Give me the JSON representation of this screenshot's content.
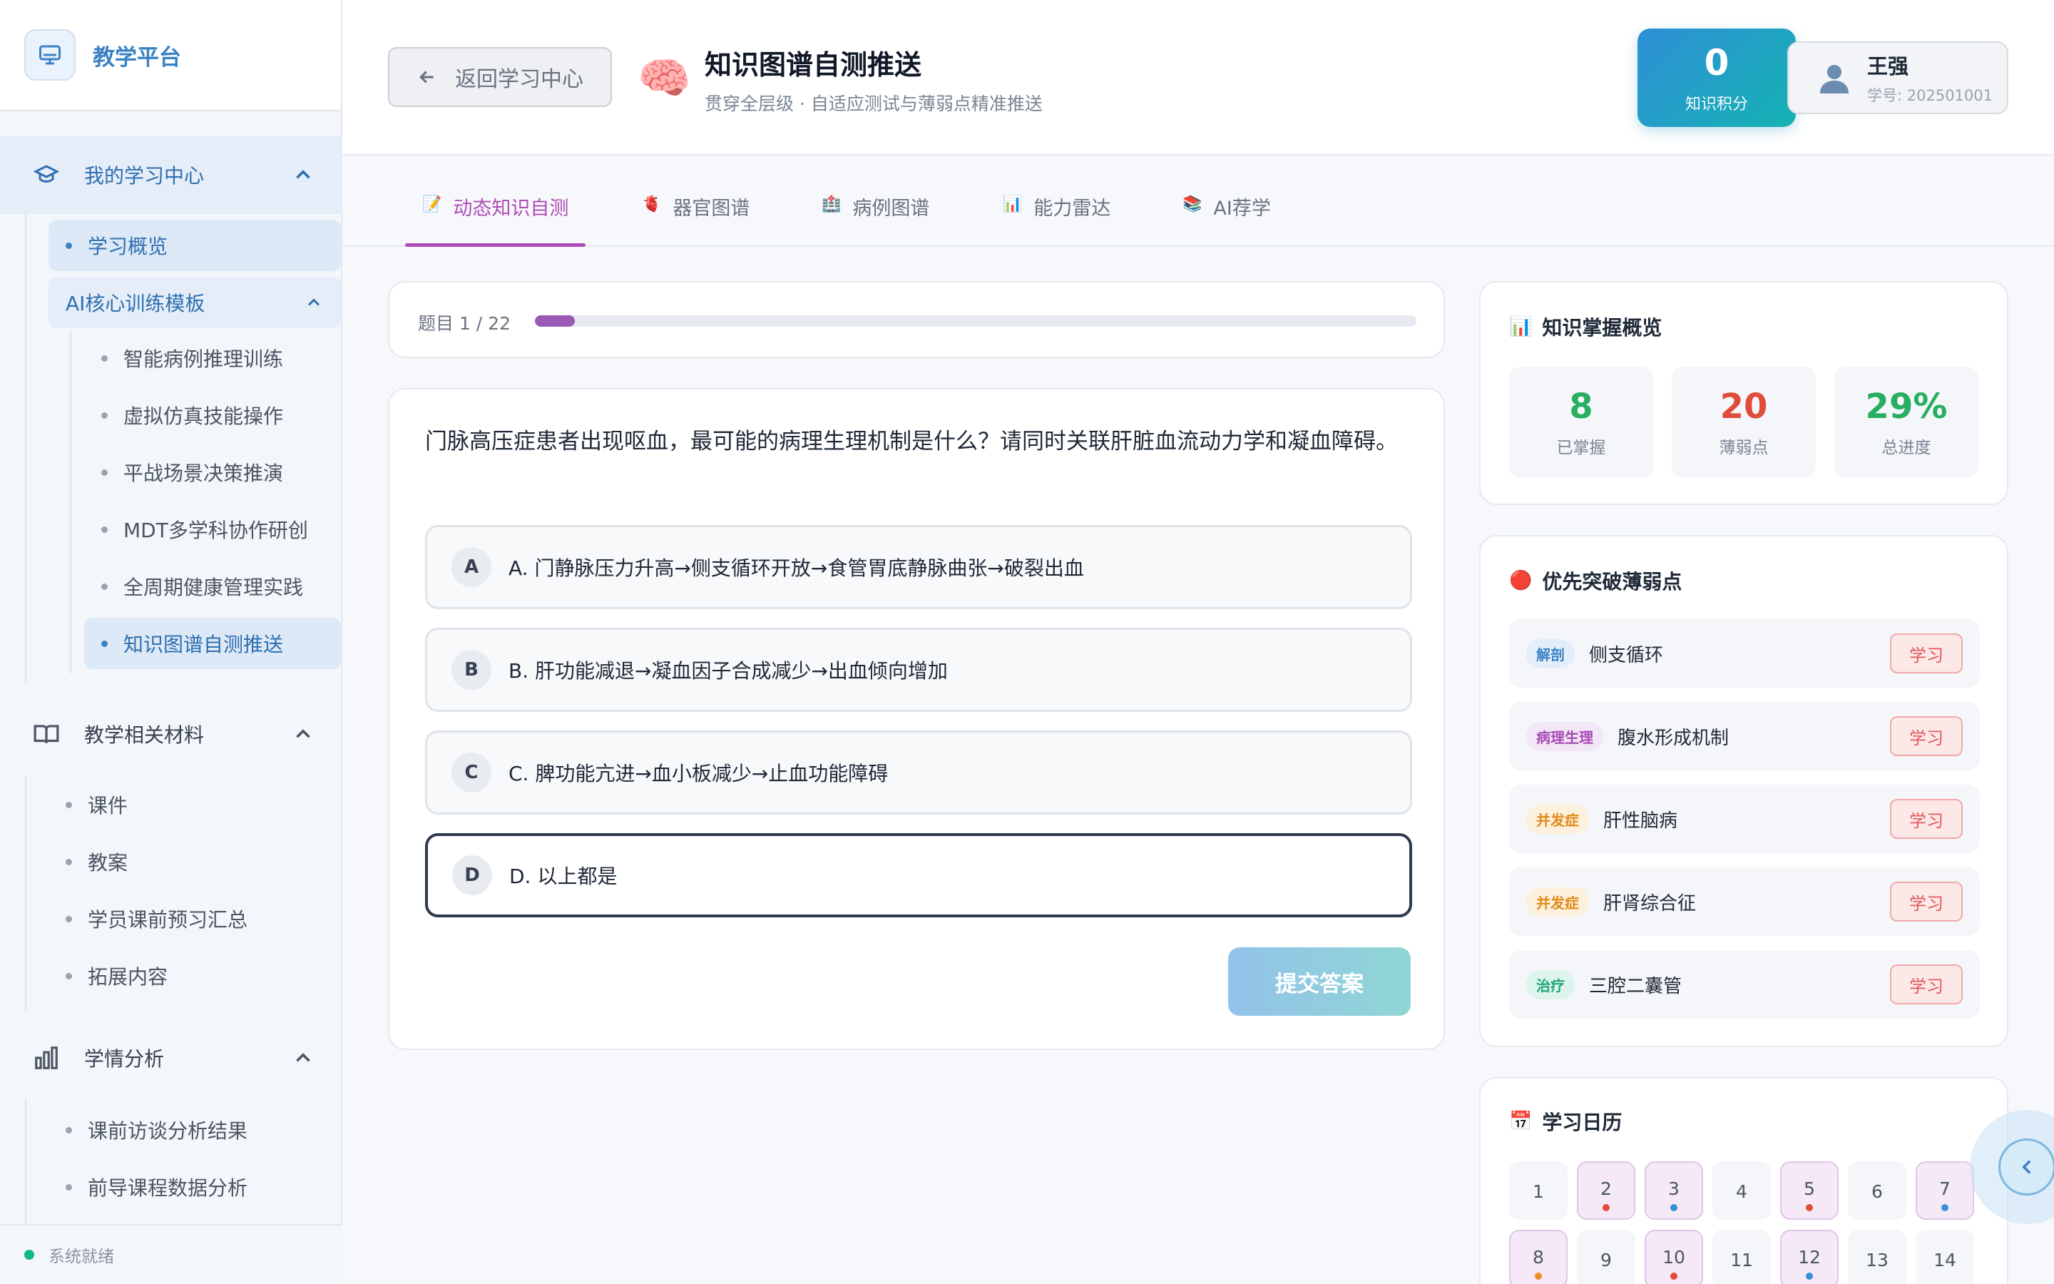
{
  "brand": {
    "name": "教学平台"
  },
  "sidebar": {
    "group1": {
      "label": "我的学习中心",
      "items": {
        "overview": "学习概览",
        "ai_template": "AI核心训练模板",
        "sub": [
          "智能病例推理训练",
          "虚拟仿真技能操作",
          "平战场景决策推演",
          "MDT多学科协作研创",
          "全周期健康管理实践",
          "知识图谱自测推送"
        ]
      }
    },
    "group2": {
      "label": "教学相关材料",
      "items": [
        "课件",
        "教案",
        "学员课前预习汇总",
        "拓展内容"
      ]
    },
    "group3": {
      "label": "学情分析",
      "items": [
        "课前访谈分析结果",
        "前导课程数据分析"
      ]
    },
    "status": "系统就绪"
  },
  "header": {
    "back_label": "返回学习中心",
    "title_icon": "🧠",
    "title": "知识图谱自测推送",
    "subtitle": "贯穿全层级 · 自适应测试与薄弱点精准推送",
    "points": {
      "value": "0",
      "label": "知识积分"
    },
    "user": {
      "name": "王强",
      "id": "学号: 202501001"
    }
  },
  "tabs": [
    {
      "icon": "📝",
      "label": "动态知识自测"
    },
    {
      "icon": "🫀",
      "label": "器官图谱"
    },
    {
      "icon": "🏥",
      "label": "病例图谱"
    },
    {
      "icon": "📊",
      "label": "能力雷达"
    },
    {
      "icon": "📚",
      "label": "AI荐学"
    }
  ],
  "progress": {
    "label": "题目 1 / 22",
    "current": 1,
    "total": 22
  },
  "question": {
    "text": "门脉高压症患者出现呕血，最可能的病理生理机制是什么？请同时关联肝脏血流动力学和凝血障碍。",
    "options": [
      {
        "letter": "A",
        "text": "A. 门静脉压力升高→侧支循环开放→食管胃底静脉曲张→破裂出血"
      },
      {
        "letter": "B",
        "text": "B. 肝功能减退→凝血因子合成减少→出血倾向增加"
      },
      {
        "letter": "C",
        "text": "C. 脾功能亢进→血小板减少→止血功能障碍"
      },
      {
        "letter": "D",
        "text": "D. 以上都是"
      }
    ],
    "selected": "D",
    "submit_label": "提交答案"
  },
  "overview": {
    "icon": "📊",
    "title": "知识掌握概览",
    "stats": [
      {
        "value": "8",
        "label": "已掌握",
        "color": "#27ae60"
      },
      {
        "value": "20",
        "label": "薄弱点",
        "color": "#e04b3a"
      },
      {
        "value": "29%",
        "label": "总进度",
        "color": "#27ae60"
      }
    ]
  },
  "weak": {
    "icon": "🔴",
    "title": "优先突破薄弱点",
    "learn_label": "学习",
    "items": [
      {
        "tag": "解剖",
        "name": "侧支循环",
        "tag_bg": "#e3eefa",
        "tag_fg": "#3b82c4"
      },
      {
        "tag": "病理生理",
        "name": "腹水形成机制",
        "tag_bg": "#f3e6f6",
        "tag_fg": "#a64bb5"
      },
      {
        "tag": "并发症",
        "name": "肝性脑病",
        "tag_bg": "#fdf0dc",
        "tag_fg": "#e08a1b"
      },
      {
        "tag": "并发症",
        "name": "肝肾综合征",
        "tag_bg": "#fdf0dc",
        "tag_fg": "#e08a1b"
      },
      {
        "tag": "治疗",
        "name": "三腔二囊管",
        "tag_bg": "#dcf4ec",
        "tag_fg": "#1ea67a"
      }
    ]
  },
  "calendar": {
    "icon": "📅",
    "title": "学习日历",
    "days": [
      {
        "n": "1"
      },
      {
        "n": "2",
        "hl": true,
        "dot": "#e04b3a"
      },
      {
        "n": "3",
        "hl": true,
        "dot": "#3b8fd6"
      },
      {
        "n": "4"
      },
      {
        "n": "5",
        "hl": true,
        "dot": "#e04b3a"
      },
      {
        "n": "6"
      },
      {
        "n": "7",
        "hl": true,
        "dot": "#3b8fd6"
      },
      {
        "n": "8",
        "hl": true,
        "dot": "#f08c1b"
      },
      {
        "n": "9"
      },
      {
        "n": "10",
        "hl": true,
        "dot": "#e04b3a"
      },
      {
        "n": "11"
      },
      {
        "n": "12",
        "hl": true,
        "dot": "#3b8fd6"
      },
      {
        "n": "13"
      },
      {
        "n": "14"
      }
    ]
  },
  "colors": {
    "accent": "#b04bb7",
    "primary": "#3b82c4",
    "progress": "#9b59b6"
  }
}
